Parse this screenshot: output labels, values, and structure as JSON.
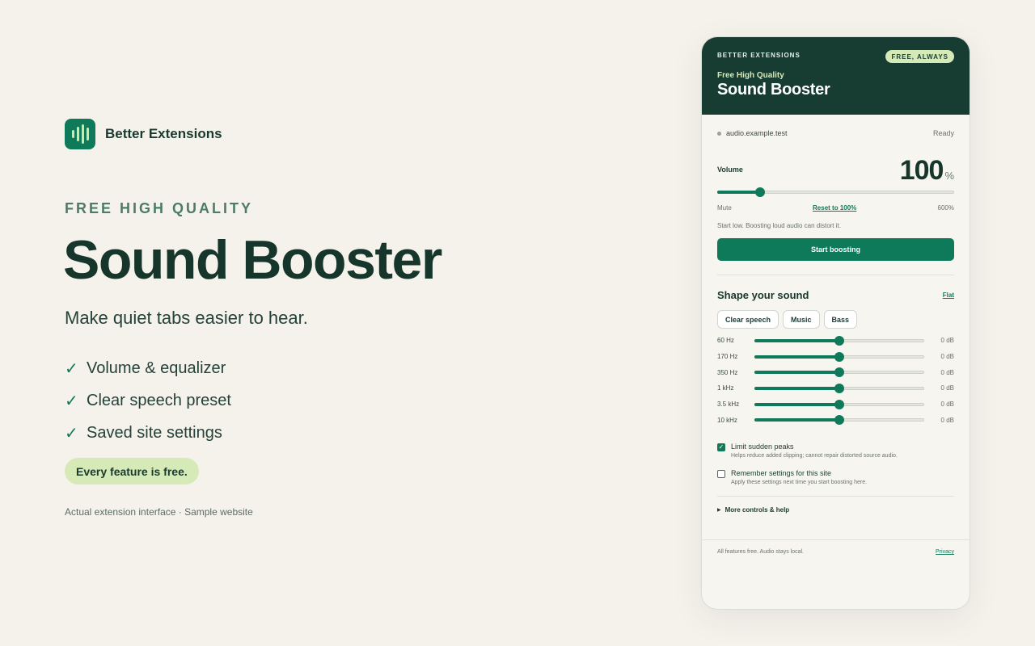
{
  "brand": {
    "name": "Better Extensions",
    "logo_icon": "sound-wave-icon"
  },
  "hero": {
    "eyebrow": "FREE HIGH QUALITY",
    "title": "Sound Booster",
    "subtitle": "Make quiet tabs easier to hear.",
    "features": [
      "Volume & equalizer",
      "Clear speech preset",
      "Saved site settings"
    ],
    "check_glyph": "✓",
    "free_badge": "Every feature is free.",
    "caption": "Actual extension interface · Sample website"
  },
  "panel": {
    "header": {
      "brand": "BETTER EXTENSIONS",
      "badge": "FREE, ALWAYS",
      "subtitle": "Free High Quality",
      "title": "Sound Booster"
    },
    "site": {
      "domain": "audio.example.test",
      "status": "Ready"
    },
    "volume": {
      "label": "Volume",
      "value": "100",
      "unit": "%",
      "level_fraction": 0.18,
      "min_label": "Mute",
      "reset_label": "Reset to 100%",
      "max_label": "600%",
      "hint": "Start low. Boosting loud audio can distort it.",
      "start_button": "Start boosting"
    },
    "eq": {
      "title": "Shape your sound",
      "flat_label": "Flat",
      "presets": [
        "Clear speech",
        "Music",
        "Bass"
      ],
      "bands": [
        {
          "label": "60 Hz",
          "value": "0 dB",
          "level_fraction": 0.5
        },
        {
          "label": "170 Hz",
          "value": "0 dB",
          "level_fraction": 0.5
        },
        {
          "label": "350 Hz",
          "value": "0 dB",
          "level_fraction": 0.5
        },
        {
          "label": "1 kHz",
          "value": "0 dB",
          "level_fraction": 0.5
        },
        {
          "label": "3.5 kHz",
          "value": "0 dB",
          "level_fraction": 0.5
        },
        {
          "label": "10 kHz",
          "value": "0 dB",
          "level_fraction": 0.5
        }
      ]
    },
    "options": {
      "limit": {
        "title": "Limit sudden peaks",
        "desc": "Helps reduce added clipping; cannot repair distorted source audio.",
        "checked": true
      },
      "remember": {
        "title": "Remember settings for this site",
        "desc": "Apply these settings next time you start boosting here.",
        "checked": false
      }
    },
    "more": {
      "label": "More controls & help",
      "icon": "triangle-right-icon"
    },
    "footer": {
      "note": "All features free. Audio stays local.",
      "privacy": "Privacy"
    }
  },
  "colors": {
    "accent": "#0f7a5a",
    "header_bg": "#173d33",
    "badge_bg": "#d6eab8",
    "page_bg": "#f5f2eb"
  }
}
